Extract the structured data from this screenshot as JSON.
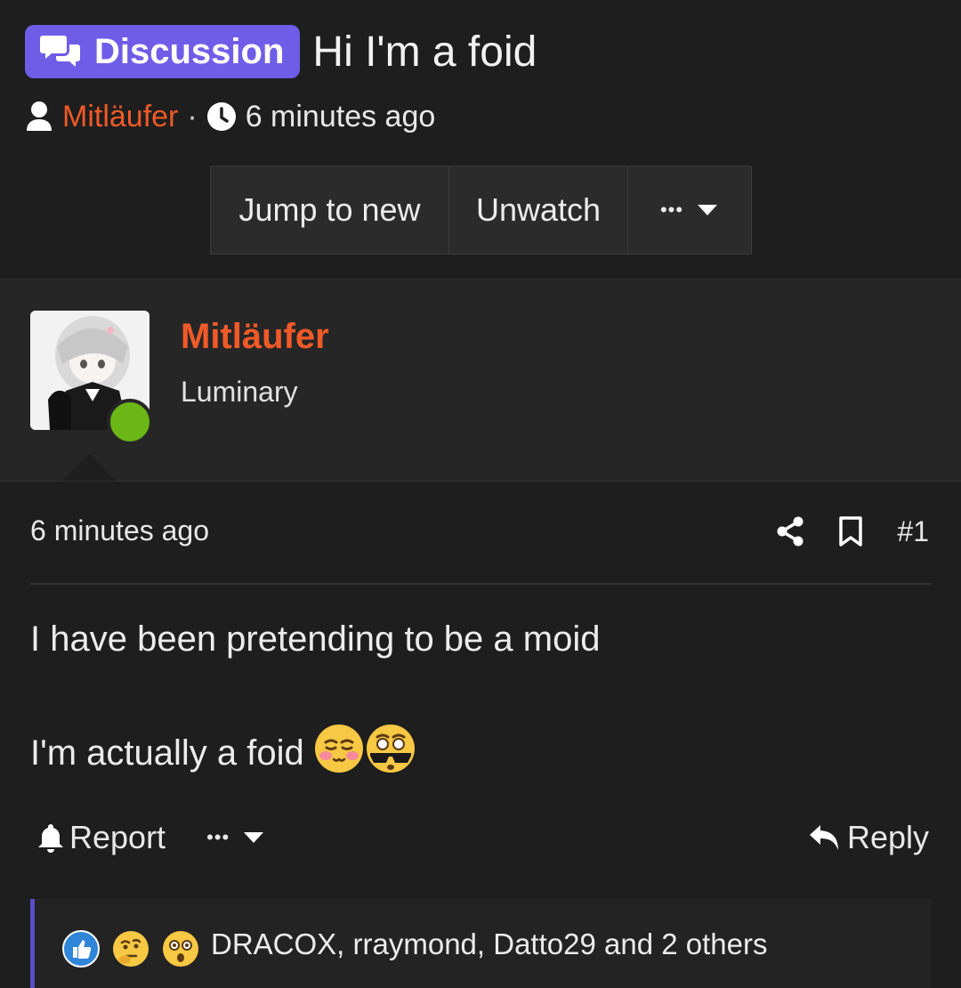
{
  "thread": {
    "prefix": "Discussion",
    "title": "Hi I'm a foid",
    "author": "Mitläufer",
    "separator": "·",
    "time": "6 minutes ago"
  },
  "toolbar": {
    "jump_label": "Jump to new",
    "unwatch_label": "Unwatch",
    "more_label": "•••"
  },
  "post": {
    "user_name": "Mitläufer",
    "user_title": "Luminary",
    "time": "6 minutes ago",
    "number": "#1",
    "line1": "I have been pretending to be a moid",
    "line2": "I'm actually a foid",
    "report_label": "Report",
    "more_label": "•••",
    "reply_label": "Reply"
  },
  "reactions": {
    "icons": [
      "like-icon",
      "thinking-icon",
      "wow-icon"
    ],
    "text": "DRACOX, rraymond, Datto29 and 2 others"
  },
  "colors": {
    "background": "#1e1e1e",
    "panel": "#262626",
    "accent_purple": "#6f5de8",
    "username_orange": "#f05a28",
    "online_green": "#6ab715"
  }
}
